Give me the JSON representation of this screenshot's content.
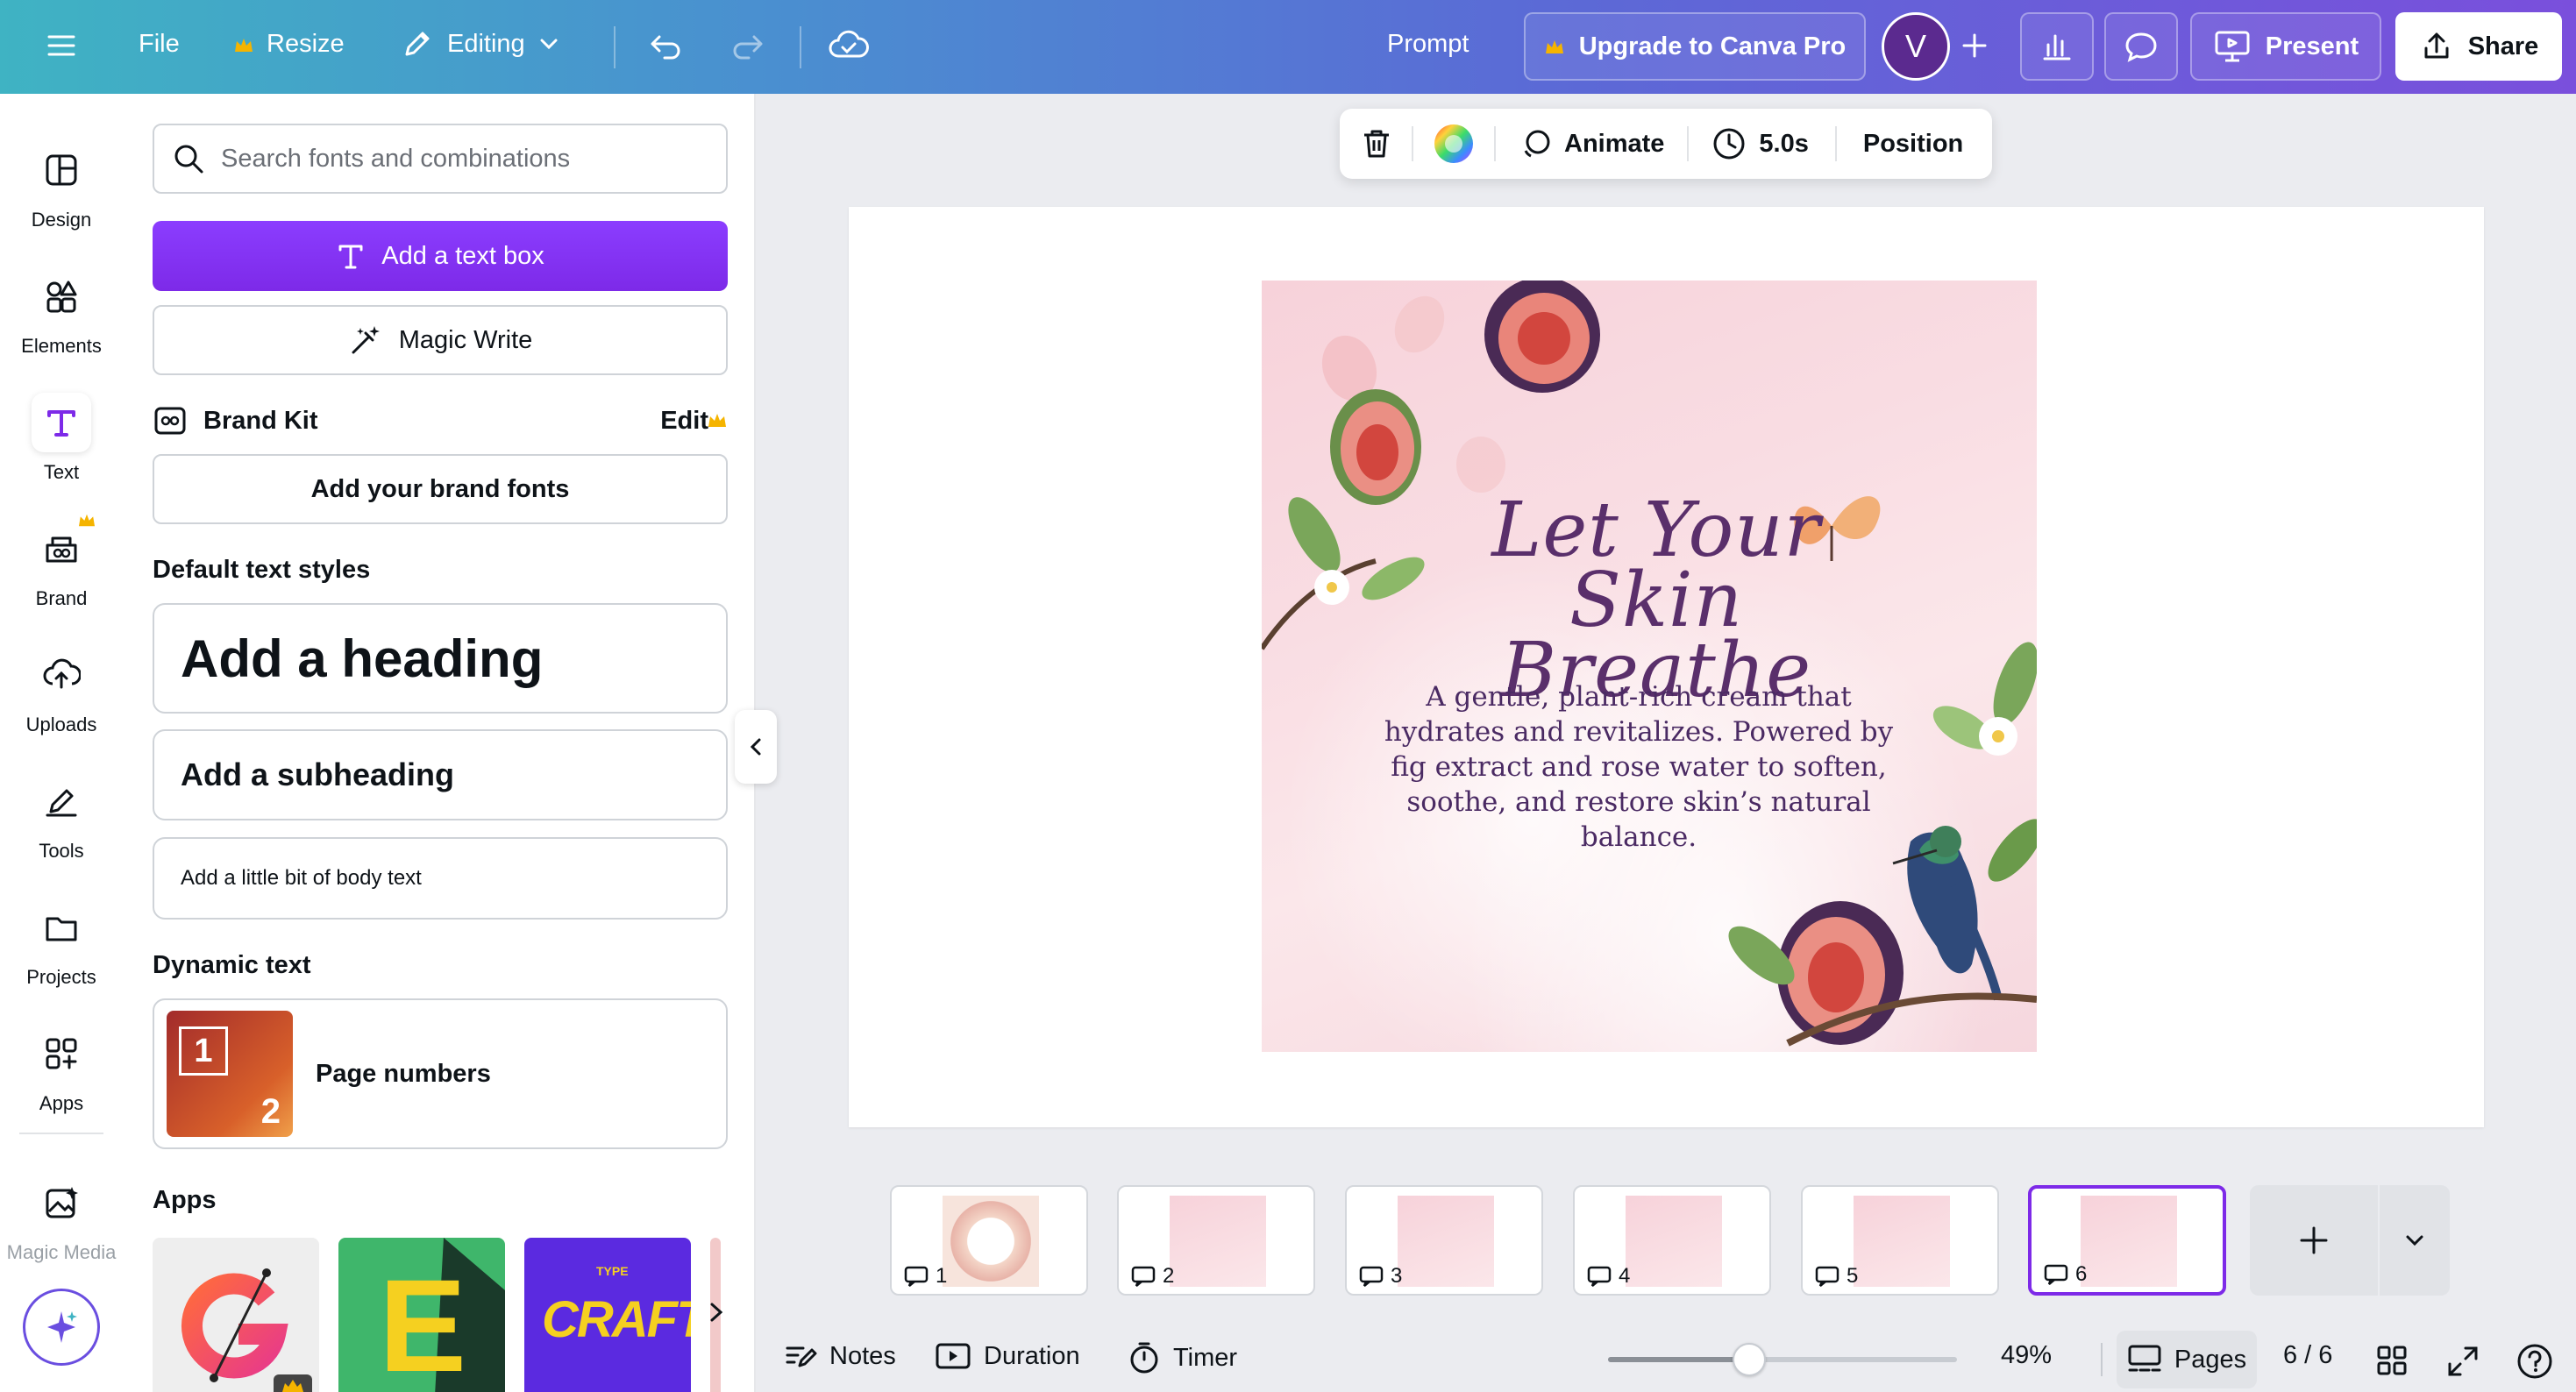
{
  "topbar": {
    "file_label": "File",
    "resize_label": "Resize",
    "editing_label": "Editing",
    "prompt_label": "Prompt",
    "upgrade_label": "Upgrade to Canva Pro",
    "avatar_initial": "V",
    "present_label": "Present",
    "share_label": "Share"
  },
  "rail": {
    "items": [
      {
        "label": "Design",
        "icon": "design-icon"
      },
      {
        "label": "Elements",
        "icon": "elements-icon"
      },
      {
        "label": "Text",
        "icon": "text-icon"
      },
      {
        "label": "Brand",
        "icon": "brand-icon"
      },
      {
        "label": "Uploads",
        "icon": "uploads-icon"
      },
      {
        "label": "Tools",
        "icon": "tools-icon"
      },
      {
        "label": "Projects",
        "icon": "projects-icon"
      },
      {
        "label": "Apps",
        "icon": "apps-icon"
      },
      {
        "label": "Magic Media",
        "icon": "magic-media-icon"
      }
    ],
    "active": "Text"
  },
  "panel": {
    "search_placeholder": "Search fonts and combinations",
    "add_text_box": "Add a text box",
    "magic_write": "Magic Write",
    "brand_kit": "Brand Kit",
    "brand_kit_edit": "Edit",
    "add_brand_fonts": "Add your brand fonts",
    "default_styles_title": "Default text styles",
    "heading": "Add a heading",
    "subheading": "Add a subheading",
    "body": "Add a little bit of body text",
    "dynamic_title": "Dynamic text",
    "page_numbers": "Page numbers",
    "page_numbers_thumb": [
      "1",
      "2"
    ],
    "apps_title": "Apps",
    "app_tile_text": [
      "E",
      "TYPE",
      "CRAFT"
    ]
  },
  "toolbar": {
    "animate": "Animate",
    "duration": "5.0s",
    "position": "Position"
  },
  "design": {
    "title_line1": "Let Your",
    "title_line2": "Skin Breathe",
    "body": "A gentle, plant-rich cream that hydrates and revitalizes. Powered by fig extract and rose water to soften, soothe, and restore skin’s natural balance."
  },
  "pages": [
    {
      "num": "1"
    },
    {
      "num": "2"
    },
    {
      "num": "3"
    },
    {
      "num": "4"
    },
    {
      "num": "5"
    },
    {
      "num": "6"
    }
  ],
  "active_page": 6,
  "bottombar": {
    "notes": "Notes",
    "duration": "Duration",
    "timer": "Timer",
    "zoom": "49%",
    "zoom_level": 0.49,
    "pages": "Pages",
    "page_count": "6 / 6"
  },
  "colors": {
    "accent": "#7d2ae8",
    "premium_crown": "#f5b400",
    "script_text": "#5a2f6b"
  }
}
